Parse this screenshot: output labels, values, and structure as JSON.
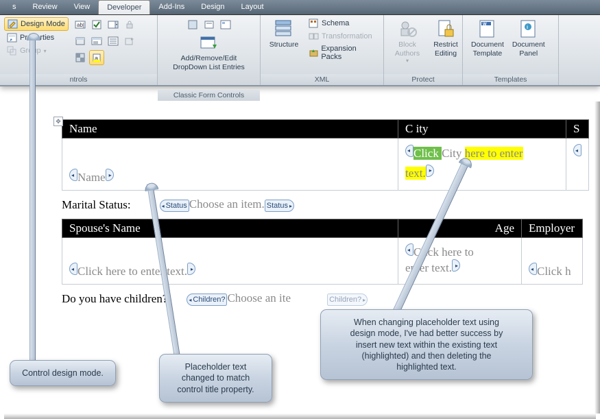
{
  "tabs": {
    "s": "s",
    "review": "Review",
    "view": "View",
    "developer": "Developer",
    "addins": "Add-Ins",
    "design": "Design",
    "layout": "Layout"
  },
  "ribbon": {
    "controls": {
      "design_mode": "Design Mode",
      "properties": "Properties",
      "group": "Group",
      "label": "ntrols"
    },
    "classic": {
      "addremove": "Add/Remove/Edit\nDropDown List Entries",
      "label": "Classic Form Controls"
    },
    "xml": {
      "structure": "Structure",
      "schema": "Schema",
      "transformation": "Transformation",
      "expansion": "Expansion Packs",
      "label": "XML"
    },
    "protect": {
      "block": "Block\nAuthors",
      "restrict": "Restrict\nEditing",
      "label": "Protect"
    },
    "templates": {
      "doctpl": "Document\nTemplate",
      "docpanel": "Document\nPanel",
      "label": "Templates"
    }
  },
  "table": {
    "headers": {
      "name": "Name",
      "city": "C ity",
      "s": "S"
    },
    "name_tag": "Name",
    "city_click": "Click ",
    "city_word": "City ",
    "city_here": "here to enter ",
    "city_text": "text.",
    "marital_label": "Marital Status:",
    "status_tag": "Status",
    "choose": "Choose an item.",
    "headers2": {
      "spouse": "Spouse's Name",
      "age": "Age",
      "employer": "Employer"
    },
    "click_enter": "Click here to enter text.",
    "click_enter2": "Click here to\nenter text.",
    "clickh": "Click h",
    "children_label": "Do you have children?",
    "children_tag": "Children?",
    "choose2": "Choose an ite",
    "children_tag2": "Children?"
  },
  "callouts": {
    "c1": "Control design mode.",
    "c2": "Placeholder text\nchanged to match\ncontrol title property.",
    "c3": "When changing placeholder text using\ndesign mode, I've had better success by\ninsert new text within the existing text\n(highlighted) and then deleting the\nhighlighted text."
  }
}
